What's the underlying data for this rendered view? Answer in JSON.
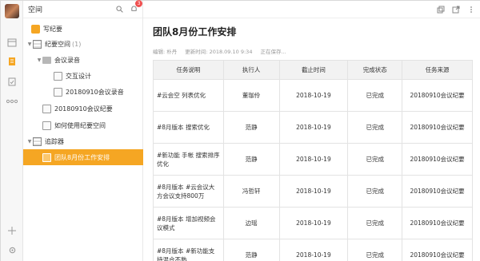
{
  "sidebar": {
    "title": "空间",
    "badge": "3",
    "items": [
      {
        "label": "写纪要",
        "icon": "edit-icon"
      },
      {
        "label": "纪要空间",
        "count": "(1)"
      },
      {
        "label": "会议录音"
      },
      {
        "label": "交互设计"
      },
      {
        "label": "20180910会议录音"
      },
      {
        "label": "20180910会议纪要"
      },
      {
        "label": "如何使用纪要空间"
      },
      {
        "label": "追踪器"
      },
      {
        "label": "团队8月份工作安排"
      }
    ]
  },
  "document": {
    "title": "团队8月份工作安排",
    "meta": {
      "editor_label": "编辑:",
      "editor": "朴丹",
      "updated_label": "更新时间:",
      "updated": "2018.09.10",
      "time": "9:34",
      "status": "正在保存..."
    }
  },
  "table": {
    "headers": [
      "任务说明",
      "执行人",
      "截止时间",
      "完成状态",
      "任务来源"
    ],
    "rows": [
      [
        "#云会空 列表优化",
        "董珈伶",
        "2018-10-19",
        "已完成",
        "20180910会议纪要"
      ],
      [
        "#8月版本 搜索优化",
        "范静",
        "2018-10-19",
        "已完成",
        "20180910会议纪要"
      ],
      [
        "#新功能 手帐 搜索排序优化",
        "范静",
        "2018-10-19",
        "已完成",
        "20180910会议纪要"
      ],
      [
        "#8月版本 #云会议大方会议支持800万",
        "冯哲轩",
        "2018-10-19",
        "已完成",
        "20180910会议纪要"
      ],
      [
        "#8月版本 增加视频会议模式",
        "边瑶",
        "2018-10-19",
        "已完成",
        "20180910会议纪要"
      ],
      [
        "#8月版本 #新功能支持混合不熟",
        "范静",
        "2018-10-19",
        "已完成",
        "20180910会议纪要"
      ]
    ]
  },
  "colors": {
    "accent": "#f5a623",
    "badge": "#f05050"
  }
}
